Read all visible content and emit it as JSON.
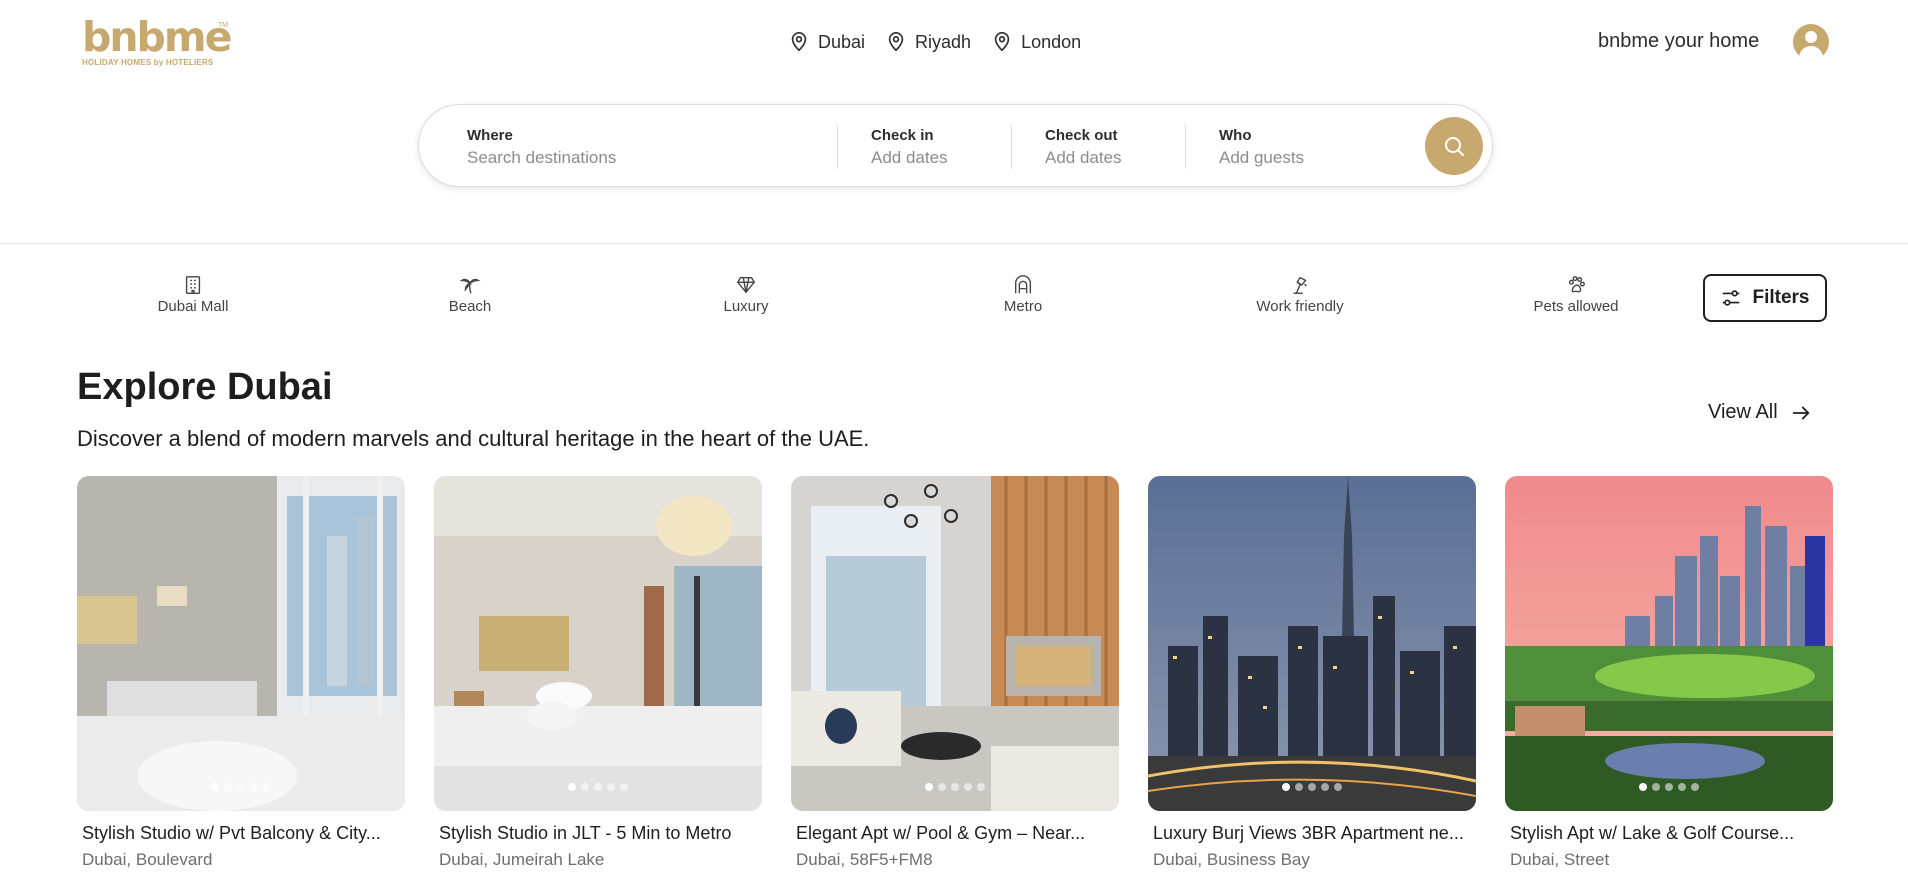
{
  "brand": {
    "logo_text": "bnbme",
    "logo_tagline": "HOLIDAY HOMES by HOTELIERS",
    "logo_tm": "TM",
    "accent_color": "#c7a86f"
  },
  "header": {
    "cities": [
      {
        "label": "Dubai",
        "icon": "map-pin-icon"
      },
      {
        "label": "Riyadh",
        "icon": "map-pin-icon"
      },
      {
        "label": "London",
        "icon": "map-pin-icon"
      }
    ],
    "host_link": "bnbme your home",
    "avatar_icon": "user-avatar-icon"
  },
  "search": {
    "where_label": "Where",
    "where_placeholder": "Search destinations",
    "checkin_label": "Check in",
    "checkin_placeholder": "Add dates",
    "checkout_label": "Check out",
    "checkout_placeholder": "Add dates",
    "who_label": "Who",
    "who_placeholder": "Add guests",
    "button_icon": "search-icon"
  },
  "categories": [
    {
      "label": "Dubai Mall",
      "icon": "building-icon"
    },
    {
      "label": "Beach",
      "icon": "palm-tree-icon"
    },
    {
      "label": "Luxury",
      "icon": "diamond-icon"
    },
    {
      "label": "Metro",
      "icon": "metro-icon"
    },
    {
      "label": "Work friendly",
      "icon": "desk-lamp-icon"
    },
    {
      "label": "Pets allowed",
      "icon": "paw-icon"
    }
  ],
  "filters_label": "Filters",
  "explore": {
    "title": "Explore Dubai",
    "subtitle": "Discover a blend of modern marvels and cultural heritage in the heart of the UAE.",
    "view_all": "View All"
  },
  "listings": [
    {
      "title": "Stylish Studio w/ Pvt Balcony & City...",
      "location": "Dubai, Boulevard",
      "photo": "studio bedroom with balcony view",
      "active_dot": 1
    },
    {
      "title": "Stylish Studio in JLT - 5 Min to Metro",
      "location": "Dubai, Jumeirah Lake",
      "photo": "studio bedroom with pendant light",
      "active_dot": 1
    },
    {
      "title": "Elegant Apt w/ Pool & Gym – Near...",
      "location": "Dubai, 58F5+FM8",
      "photo": "living room with chandelier",
      "active_dot": 1
    },
    {
      "title": "Luxury Burj Views 3BR Apartment ne...",
      "location": "Dubai, Business Bay",
      "photo": "night skyline with Burj Khalifa",
      "active_dot": 1
    },
    {
      "title": "Stylish Apt w/ Lake & Golf Course...",
      "location": "Dubai, Street",
      "photo": "golf course and skyline at dusk",
      "active_dot": 1
    }
  ]
}
